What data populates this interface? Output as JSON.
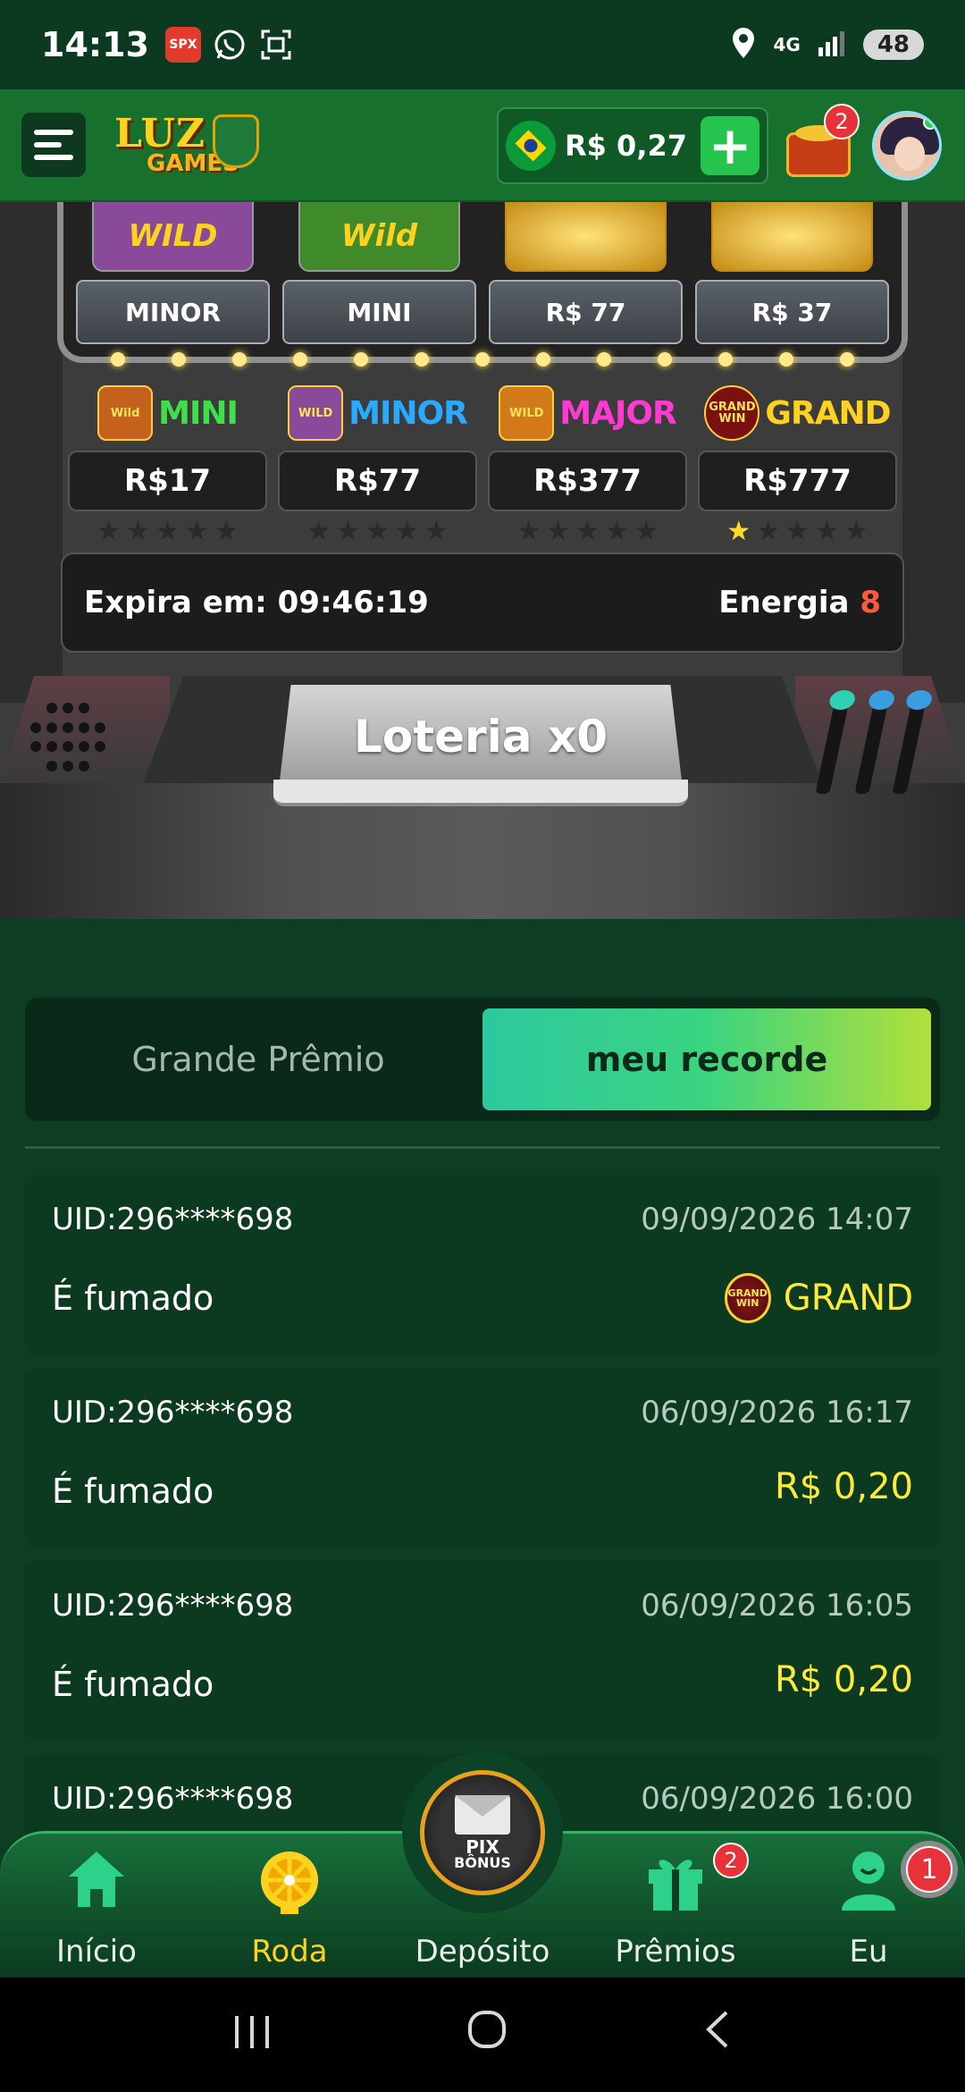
{
  "status_bar": {
    "time": "14:13",
    "network": "4G",
    "battery": "48"
  },
  "header": {
    "logo_line1": "LUZ",
    "logo_line2": "GAMES",
    "balance": "R$ 0,27",
    "add_label": "+",
    "gift_badge": "2"
  },
  "reels": [
    {
      "art": "WILD",
      "label": "MINOR"
    },
    {
      "art": "Wild",
      "label": "MINI"
    },
    {
      "art": "",
      "label": "R$ 77"
    },
    {
      "art": "",
      "label": "R$ 37"
    }
  ],
  "jackpots": [
    {
      "icon": "Wild",
      "name": "MINI",
      "value": "R$17",
      "stars_on": 0,
      "color": "#3ee04a"
    },
    {
      "icon": "WILD",
      "name": "MINOR",
      "value": "R$77",
      "stars_on": 0,
      "color": "#2aa9ff"
    },
    {
      "icon": "WILD",
      "name": "MAJOR",
      "value": "R$377",
      "stars_on": 0,
      "color": "#ff3ad2"
    },
    {
      "icon": "GRAND WIN",
      "name": "GRAND",
      "value": "R$777",
      "stars_on": 1,
      "color": "#ffd21f"
    }
  ],
  "energy": {
    "expires_label": "Expira em:",
    "expires_value": "09:46:19",
    "energy_label": "Energia",
    "energy_value": "8"
  },
  "lottery_button": "Loteria x0",
  "tabs": {
    "grand_prize": "Grande Prêmio",
    "my_record": "meu recorde"
  },
  "records": [
    {
      "uid": "UID:296****698",
      "date": "09/09/2026 14:07",
      "status": "É fumado",
      "prize": "GRAND",
      "has_icon": true,
      "icon_text": "GRAND WIN"
    },
    {
      "uid": "UID:296****698",
      "date": "06/09/2026 16:17",
      "status": "É fumado",
      "prize": "R$ 0,20",
      "has_icon": false
    },
    {
      "uid": "UID:296****698",
      "date": "06/09/2026 16:05",
      "status": "É fumado",
      "prize": "R$ 0,20",
      "has_icon": false
    },
    {
      "uid": "UID:296****698",
      "date": "06/09/2026 16:00",
      "status": "",
      "prize": "",
      "has_icon": false
    }
  ],
  "bottom_nav": {
    "home": "Início",
    "wheel": "Roda",
    "deposit": "Depósito",
    "pix_line1": "PIX",
    "pix_line2": "BÔNUS",
    "prizes": "Prêmios",
    "prizes_badge": "2",
    "me": "Eu",
    "me_badge": "1"
  },
  "colors": {
    "accent_yellow": "#ffd21f",
    "accent_green": "#25c44e",
    "background": "#0d3d22"
  }
}
